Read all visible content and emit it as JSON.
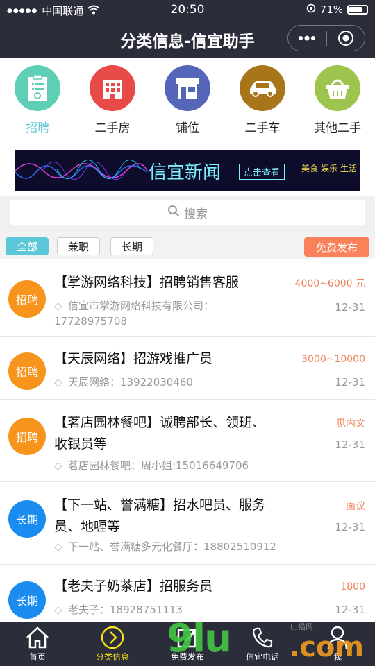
{
  "status_bar": {
    "carrier": "中国联通",
    "time": "20:50",
    "battery": "71%",
    "battery_level": 0.71
  },
  "nav": {
    "title": "分类信息-信宜助手",
    "more_icon": "more-dots-icon",
    "close_icon": "target-icon"
  },
  "categories": [
    {
      "label": "招聘",
      "icon": "clipboard-icon",
      "color": "#5ecfb4",
      "active": true
    },
    {
      "label": "二手房",
      "icon": "building-icon",
      "color": "#e84a48",
      "active": false
    },
    {
      "label": "铺位",
      "icon": "shop-icon",
      "color": "#5566b8",
      "active": false
    },
    {
      "label": "二手车",
      "icon": "car-icon",
      "color": "#a8751b",
      "active": false
    },
    {
      "label": "其他二手",
      "icon": "basket-icon",
      "color": "#9dc44c",
      "active": false
    }
  ],
  "banner": {
    "title": "信宜新闻",
    "button": "点击查看",
    "side_left": "美食",
    "side_mid": "娱乐",
    "side_right": "生活"
  },
  "search": {
    "placeholder": "搜索"
  },
  "filters": {
    "all": "全部",
    "parttime": "兼职",
    "longterm": "长期",
    "publish": "免费发布"
  },
  "colors": {
    "accent": "#5cc7d8",
    "orange": "#f7941d",
    "blue": "#1a8cf0",
    "price": "#f0825a",
    "nav_bg": "#2b2d3a",
    "tab_active": "#f7e21c"
  },
  "listings": [
    {
      "badge": "招聘",
      "badge_color": "#f7941d",
      "title": "【掌游网络科技】招聘销售客服",
      "price": "4000~6000 元",
      "sub": "信宜市掌游网络科技有限公司：17728975708",
      "date": "12-31"
    },
    {
      "badge": "招聘",
      "badge_color": "#f7941d",
      "title": "【天辰网络】招游戏推广员",
      "price": "3000~10000",
      "sub": "天辰网络：13922030460",
      "date": "12-31"
    },
    {
      "badge": "招聘",
      "badge_color": "#f7941d",
      "title": "【茗店园林餐吧】诚聘部长、领班、收银员等",
      "price": "见内文",
      "sub": "茗店园林餐吧：周小姐:15016649706",
      "date": "12-31"
    },
    {
      "badge": "长期",
      "badge_color": "#1a8cf0",
      "title": "【下一站、誉满糖】招水吧员、服务员、地喱等",
      "price": "面议",
      "sub": "下一站、誉满糖多元化餐厅：18802510912",
      "date": "12-31"
    },
    {
      "badge": "长期",
      "badge_color": "#1a8cf0",
      "title": "【老夫子奶茶店】招服务员",
      "price": "1800",
      "sub": "老夫子：18928751113",
      "date": "12-31"
    }
  ],
  "tabs": [
    {
      "label": "首页",
      "icon": "home-icon",
      "active": false
    },
    {
      "label": "分类信息",
      "icon": "chevron-circle-icon",
      "active": true
    },
    {
      "label": "免费发布",
      "icon": "edit-icon",
      "active": false
    },
    {
      "label": "信宜电话",
      "icon": "phone-icon",
      "active": false
    },
    {
      "label": "我",
      "icon": "user-icon",
      "active": false
    }
  ],
  "watermark": {
    "text": "9lu",
    "domain": ".com",
    "small": "山猫网"
  }
}
